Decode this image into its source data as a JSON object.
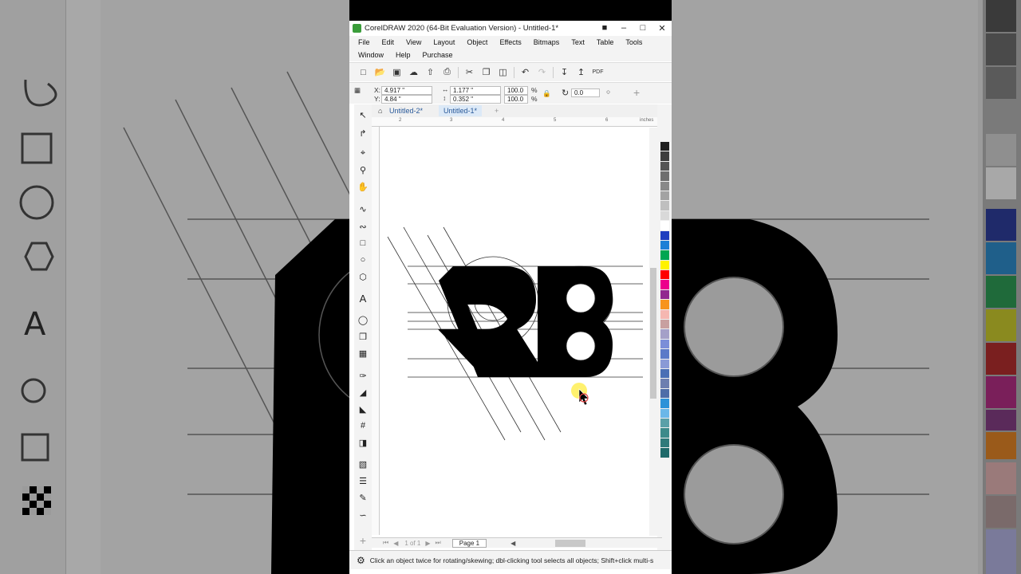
{
  "window": {
    "title": "CorelDRAW 2020 (64-Bit Evaluation Version) - Untitled-1*",
    "controls": [
      "minimize",
      "maximize",
      "close"
    ]
  },
  "menu": {
    "row1": [
      "File",
      "Edit",
      "View",
      "Layout",
      "Object",
      "Effects",
      "Bitmaps",
      "Text",
      "Table",
      "Tools"
    ],
    "row2": [
      "Window",
      "Help",
      "Purchase"
    ]
  },
  "property_bar": {
    "x_label": "X:",
    "x_value": "4.917 \"",
    "y_label": "Y:",
    "y_value": "4.84 \"",
    "width_value": "1.177 \"",
    "height_value": "0.352 \"",
    "scale_x": "100.0",
    "scale_y": "100.0",
    "percent": "%",
    "rotation": "0.0"
  },
  "tabs": [
    {
      "label": "Untitled-2*",
      "active": false
    },
    {
      "label": "Untitled-1*",
      "active": true
    }
  ],
  "ruler": {
    "unit": "inches",
    "ticks": [
      "2",
      "3",
      "4",
      "5",
      "6"
    ]
  },
  "page_nav": {
    "page_count_text": "1 of 1",
    "page_tab": "Page 1"
  },
  "status": {
    "hint": "Click an object twice for rotating/skewing; dbl-clicking tool selects all objects; Shift+click multi-s"
  },
  "palette_colors": [
    "#1f1f1f",
    "#3d3d3d",
    "#555555",
    "#6e6e6e",
    "#888888",
    "#a3a3a3",
    "#bfbfbf",
    "#d9d9d9",
    "#ffffff",
    "#1f3fbf",
    "#1c7fd6",
    "#00a651",
    "#fff200",
    "#ff0000",
    "#ec008c",
    "#92278f",
    "#f7941d",
    "#f5b7b1",
    "#c8a0a0",
    "#a4a0c8",
    "#7b8ed8",
    "#5b7ac8",
    "#8a9ad6",
    "#4a6fb5",
    "#6d7fb0",
    "#4e6da8",
    "#2d92d8",
    "#6bb7e8",
    "#5aa0a8",
    "#3c8a8a",
    "#2f7a7a",
    "#1f6a6a"
  ],
  "colors": {
    "accent_green": "#3a9d3a",
    "tab_active": "#dce9f7",
    "cursor_highlight": "#ffee55"
  }
}
